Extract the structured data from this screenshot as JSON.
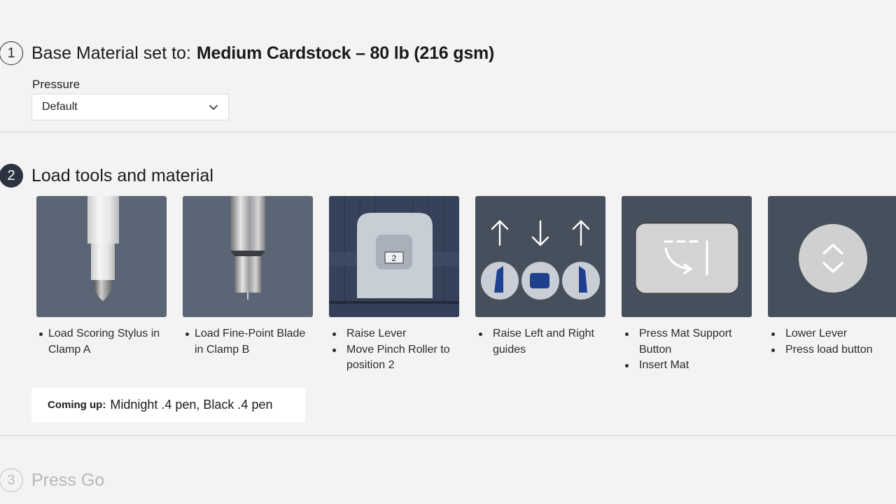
{
  "step1": {
    "number": "1",
    "title": "Base Material set to:",
    "material": "Medium Cardstock – 80 lb (216 gsm)",
    "pressure_label": "Pressure",
    "pressure_value": "Default"
  },
  "step2": {
    "number": "2",
    "title": "Load tools and material",
    "cards": [
      {
        "image": "scoring-stylus",
        "bullets": [
          "Load Scoring Stylus in Clamp A"
        ]
      },
      {
        "image": "fine-point-blade",
        "bullets": [
          "Load Fine-Point Blade in Clamp B"
        ]
      },
      {
        "image": "pinch-roller-position",
        "position_label": "2",
        "bullets": [
          "Raise Lever",
          "Move Pinch Roller to position 2"
        ]
      },
      {
        "image": "mat-guides",
        "bullets": [
          "Raise Left and Right guides"
        ]
      },
      {
        "image": "mat-support-button",
        "bullets": [
          "Press Mat Support Button",
          "Insert Mat"
        ]
      },
      {
        "image": "load-button",
        "bullets": [
          "Lower Lever",
          "Press load button"
        ]
      }
    ],
    "coming_up_label": "Coming up:",
    "coming_up_value": "Midnight .4 pen, Black .4 pen"
  },
  "step3": {
    "number": "3",
    "title": "Press Go"
  },
  "colors": {
    "background": "#f3f3f3",
    "active_step": "#2c3340",
    "card_bg": "#5a6676",
    "card_bg_dark": "#464f5c",
    "guide_blue": "#1f3f8f",
    "disabled_text": "#b8b8b8"
  }
}
